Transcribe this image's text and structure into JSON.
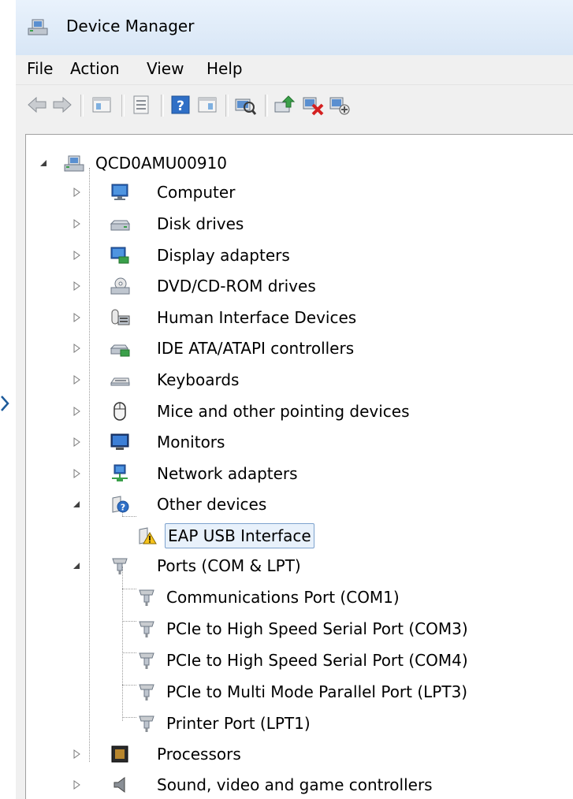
{
  "window": {
    "title": "Device Manager",
    "title_icon": "device-manager-icon"
  },
  "menu": [
    "File",
    "Action",
    "View",
    "Help"
  ],
  "toolbar": {
    "buttons": [
      "back-icon",
      "forward-icon",
      "show-hide-console-tree-icon",
      "properties-icon",
      "help-icon",
      "show-hide-action-pane-icon",
      "scan-hardware-icon",
      "update-driver-icon",
      "uninstall-icon",
      "disable-icon"
    ]
  },
  "tree": {
    "root": "QCD0AMU00910",
    "categories": [
      {
        "label": "Computer",
        "icon": "computer-icon",
        "expanded": false
      },
      {
        "label": "Disk drives",
        "icon": "disk-drive-icon",
        "expanded": false
      },
      {
        "label": "Display adapters",
        "icon": "display-adapter-icon",
        "expanded": false
      },
      {
        "label": "DVD/CD-ROM drives",
        "icon": "dvd-drive-icon",
        "expanded": false
      },
      {
        "label": "Human Interface Devices",
        "icon": "hid-icon",
        "expanded": false
      },
      {
        "label": "IDE ATA/ATAPI controllers",
        "icon": "ide-controller-icon",
        "expanded": false
      },
      {
        "label": "Keyboards",
        "icon": "keyboard-icon",
        "expanded": false
      },
      {
        "label": "Mice and other pointing devices",
        "icon": "mouse-icon",
        "expanded": false
      },
      {
        "label": "Monitors",
        "icon": "monitor-icon",
        "expanded": false
      },
      {
        "label": "Network adapters",
        "icon": "network-adapter-icon",
        "expanded": false
      },
      {
        "label": "Other devices",
        "icon": "unknown-device-icon",
        "expanded": true,
        "children": [
          {
            "label": "EAP USB Interface",
            "icon": "warning-device-icon",
            "selected": true
          }
        ]
      },
      {
        "label": "Ports (COM & LPT)",
        "icon": "port-icon",
        "expanded": true,
        "children": [
          {
            "label": "Communications Port (COM1)",
            "icon": "port-icon"
          },
          {
            "label": "PCIe to High Speed Serial Port (COM3)",
            "icon": "port-icon"
          },
          {
            "label": "PCIe to High Speed Serial Port (COM4)",
            "icon": "port-icon"
          },
          {
            "label": "PCIe to Multi Mode Parallel Port (LPT3)",
            "icon": "port-icon"
          },
          {
            "label": "Printer Port (LPT1)",
            "icon": "port-icon"
          }
        ]
      },
      {
        "label": "Processors",
        "icon": "processor-icon",
        "expanded": false
      },
      {
        "label": "Sound, video and game controllers",
        "icon": "sound-icon",
        "expanded": false
      }
    ]
  },
  "colors": {
    "selection_border": "#7da2ce",
    "selection_fill": "#e8f1fb",
    "titlebar_top": "#e9f2fc",
    "titlebar_bottom": "#d8e6f6"
  }
}
